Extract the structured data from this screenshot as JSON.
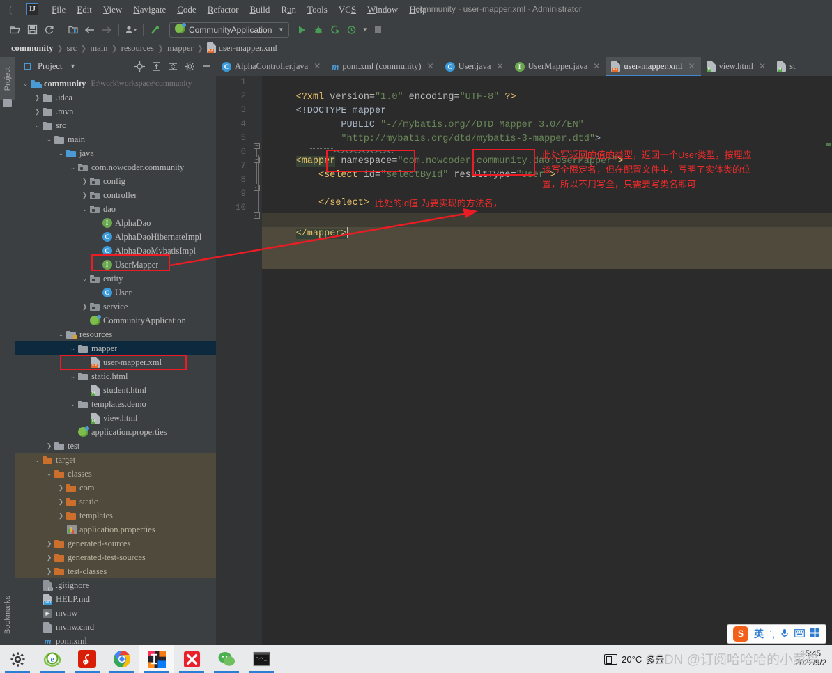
{
  "window": {
    "title": "community - user-mapper.xml - Administrator",
    "logo": "ij-logo"
  },
  "menubar": {
    "items": [
      {
        "label": "File",
        "mnemonic": "F"
      },
      {
        "label": "Edit",
        "mnemonic": "E"
      },
      {
        "label": "View",
        "mnemonic": "V"
      },
      {
        "label": "Navigate",
        "mnemonic": "N"
      },
      {
        "label": "Code",
        "mnemonic": "C"
      },
      {
        "label": "Refactor",
        "mnemonic": "R"
      },
      {
        "label": "Build",
        "mnemonic": "B"
      },
      {
        "label": "Run",
        "mnemonic": "u"
      },
      {
        "label": "Tools",
        "mnemonic": "T"
      },
      {
        "label": "VCS",
        "mnemonic": "S"
      },
      {
        "label": "Window",
        "mnemonic": "W"
      },
      {
        "label": "Help",
        "mnemonic": "H"
      }
    ]
  },
  "toolbar": {
    "run_config": "CommunityApplication",
    "icons": [
      "open-folder-icon",
      "save-icon",
      "sync-icon",
      "project-structure-icon",
      "back-icon",
      "forward-icon",
      "profile-icon",
      "update-icon",
      "run-icon",
      "debug-icon",
      "run-coverage-icon",
      "profiler-icon",
      "stop-icon"
    ]
  },
  "breadcrumb": {
    "items": [
      "community",
      "src",
      "main",
      "resources",
      "mapper"
    ],
    "file": "user-mapper.xml"
  },
  "tool_strip": {
    "project_label": "Project",
    "bookmarks_label": "Bookmarks"
  },
  "project_panel": {
    "title": "Project",
    "header_icons": [
      "locate-icon",
      "expand-all-icon",
      "collapse-all-icon",
      "gear-icon",
      "hide-icon"
    ],
    "tree": [
      {
        "depth": 0,
        "label": "community",
        "path": "E:\\work\\workspace\\community",
        "icon": "module-folder-icon",
        "arrow": "down",
        "bold": true
      },
      {
        "depth": 1,
        "label": ".idea",
        "icon": "folder-icon",
        "arrow": "right"
      },
      {
        "depth": 1,
        "label": ".mvn",
        "icon": "folder-icon",
        "arrow": "right"
      },
      {
        "depth": 1,
        "label": "src",
        "icon": "folder-icon",
        "arrow": "down"
      },
      {
        "depth": 2,
        "label": "main",
        "icon": "folder-icon",
        "arrow": "down"
      },
      {
        "depth": 3,
        "label": "java",
        "icon": "source-folder-icon",
        "arrow": "down"
      },
      {
        "depth": 4,
        "label": "com.nowcoder.community",
        "icon": "package-icon",
        "arrow": "down"
      },
      {
        "depth": 5,
        "label": "config",
        "icon": "package-icon",
        "arrow": "right"
      },
      {
        "depth": 5,
        "label": "controller",
        "icon": "package-icon",
        "arrow": "right"
      },
      {
        "depth": 5,
        "label": "dao",
        "icon": "package-icon",
        "arrow": "down"
      },
      {
        "depth": 6,
        "label": "AlphaDao",
        "icon": "interface-icon"
      },
      {
        "depth": 6,
        "label": "AlphaDaoHibernateImpl",
        "icon": "class-icon"
      },
      {
        "depth": 6,
        "label": "AlphaDaoMybatisImpl",
        "icon": "class-icon"
      },
      {
        "depth": 6,
        "label": "UserMapper",
        "icon": "interface-icon",
        "highlight": "red-box"
      },
      {
        "depth": 5,
        "label": "entity",
        "icon": "package-icon",
        "arrow": "down"
      },
      {
        "depth": 6,
        "label": "User",
        "icon": "class-icon"
      },
      {
        "depth": 5,
        "label": "service",
        "icon": "package-icon",
        "arrow": "right"
      },
      {
        "depth": 5,
        "label": "CommunityApplication",
        "icon": "spring-boot-icon"
      },
      {
        "depth": 3,
        "label": "resources",
        "icon": "resource-folder-icon",
        "arrow": "down"
      },
      {
        "depth": 4,
        "label": "mapper",
        "icon": "folder-icon",
        "arrow": "down",
        "selected": true
      },
      {
        "depth": 5,
        "label": "user-mapper.xml",
        "icon": "xml-file-icon",
        "highlight": "red-box"
      },
      {
        "depth": 4,
        "label": "static.html",
        "icon": "folder-icon",
        "arrow": "down"
      },
      {
        "depth": 5,
        "label": "student.html",
        "icon": "html-file-icon"
      },
      {
        "depth": 4,
        "label": "templates.demo",
        "icon": "folder-icon",
        "arrow": "down"
      },
      {
        "depth": 5,
        "label": "view.html",
        "icon": "html-file-icon"
      },
      {
        "depth": 4,
        "label": "application.properties",
        "icon": "spring-properties-icon"
      },
      {
        "depth": 2,
        "label": "test",
        "icon": "folder-icon",
        "arrow": "right"
      },
      {
        "depth": 1,
        "label": "target",
        "icon": "excluded-folder-icon",
        "arrow": "down",
        "excluded": true
      },
      {
        "depth": 2,
        "label": "classes",
        "icon": "excluded-folder-icon",
        "arrow": "down",
        "excluded": true
      },
      {
        "depth": 3,
        "label": "com",
        "icon": "excluded-folder-icon",
        "arrow": "right",
        "excluded": true
      },
      {
        "depth": 3,
        "label": "static",
        "icon": "excluded-folder-icon",
        "arrow": "right",
        "excluded": true
      },
      {
        "depth": 3,
        "label": "templates",
        "icon": "excluded-folder-icon",
        "arrow": "right",
        "excluded": true
      },
      {
        "depth": 3,
        "label": "application.properties",
        "icon": "properties-icon",
        "excluded": true
      },
      {
        "depth": 2,
        "label": "generated-sources",
        "icon": "excluded-folder-icon",
        "arrow": "right",
        "excluded": true
      },
      {
        "depth": 2,
        "label": "generated-test-sources",
        "icon": "excluded-folder-icon",
        "arrow": "right",
        "excluded": true
      },
      {
        "depth": 2,
        "label": "test-classes",
        "icon": "excluded-folder-icon",
        "arrow": "right",
        "excluded": true
      },
      {
        "depth": 1,
        "label": ".gitignore",
        "icon": "gitignore-icon"
      },
      {
        "depth": 1,
        "label": "HELP.md",
        "icon": "markdown-file-icon"
      },
      {
        "depth": 1,
        "label": "mvnw",
        "icon": "script-file-icon"
      },
      {
        "depth": 1,
        "label": "mvnw.cmd",
        "icon": "text-file-icon"
      },
      {
        "depth": 1,
        "label": "pom.xml",
        "icon": "maven-file-icon"
      }
    ]
  },
  "editor_tabs": [
    {
      "label": "AlphaController.java",
      "icon": "class-icon",
      "active": false,
      "closable": true
    },
    {
      "label": "pom.xml (community)",
      "icon": "maven-file-icon",
      "active": false,
      "closable": true
    },
    {
      "label": "User.java",
      "icon": "class-icon",
      "active": false,
      "closable": true
    },
    {
      "label": "UserMapper.java",
      "icon": "interface-icon",
      "active": false,
      "closable": true
    },
    {
      "label": "user-mapper.xml",
      "icon": "xml-file-icon",
      "active": true,
      "closable": true
    },
    {
      "label": "view.html",
      "icon": "html-file-icon",
      "active": false,
      "closable": true
    },
    {
      "label": "st",
      "icon": "html-file-icon",
      "active": false,
      "closable": false
    }
  ],
  "editor": {
    "line_numbers": [
      "1",
      "2",
      "3",
      "4",
      "5",
      "6",
      "7",
      "8",
      "9",
      "10"
    ],
    "lines": [
      "<?xml version=\"1.0\" encoding=\"UTF-8\" ?>",
      "<!DOCTYPE mapper",
      "        PUBLIC \"-//mybatis.org//DTD Mapper 3.0//EN\"",
      "        \"http://mybatis.org/dtd/mybatis-3-mapper.dtd\">",
      "<mapper namespace=\"com.nowcoder.community.dao.UserMapper\">",
      "    <select id=\"selectById\" resultType=\"User\">",
      "",
      "    </select>",
      "",
      "</mapper>"
    ]
  },
  "annotations": {
    "note_resulttype": [
      "此处写返回的值的类型，返回一个User类型，按理应",
      "该写全限定名，但在配置文件中，写明了实体类的位",
      "置，所以不用写全，只需要写类名即可"
    ],
    "note_id": "此处的id值 为要实现的方法名，",
    "box_color": "#ec1c24"
  },
  "taskbar": {
    "items": [
      {
        "icon": "settings-gear-icon",
        "active": false
      },
      {
        "icon": "ie-browser-icon",
        "active": false
      },
      {
        "icon": "netease-music-icon",
        "active": false
      },
      {
        "icon": "chrome-icon",
        "active": false
      },
      {
        "icon": "intellij-idea-icon",
        "active": true
      },
      {
        "icon": "xmind-icon",
        "active": false
      },
      {
        "icon": "wechat-icon",
        "active": false
      },
      {
        "icon": "terminal-icon",
        "active": false
      }
    ],
    "tray": {
      "temperature": "20°C",
      "weather": "多云",
      "time": "15:45",
      "date": "2022/9/2"
    },
    "watermark": "CSDN @订阅哈哈哈的小菜鸟",
    "ime": {
      "logo": "S",
      "mode": "英",
      "icons": [
        "punctuation-icon",
        "voice-input-icon",
        "keyboard-icon",
        "apps-icon"
      ]
    }
  }
}
